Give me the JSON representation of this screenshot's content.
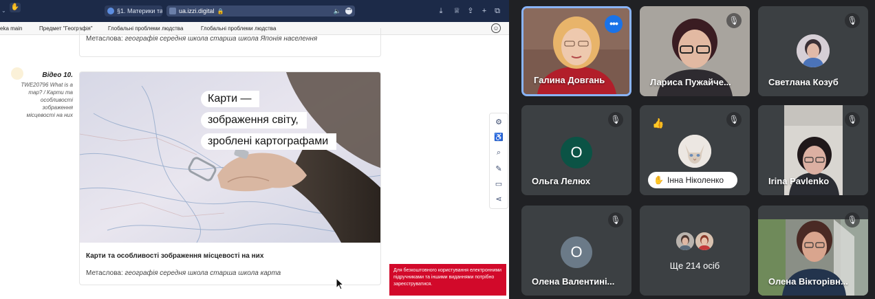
{
  "browser": {
    "tab_title": "§1. Материки та...",
    "url": "ua.izzi.digital"
  },
  "bookmarks": [
    "eka main",
    "Предмет \"Географія\"",
    "Глобальні проблеми людства",
    "Глобальні проблеми людства"
  ],
  "top_card": {
    "meta_label": "Метаслова:",
    "meta_value": "географія середня школа старша школа Японія населення"
  },
  "video": {
    "label": "Відео 10.",
    "description": "TWE20796 What is a map? / Карти та особливості зображення місцевості на них",
    "captions": [
      "Карти —",
      "зображення світу,",
      "зроблені картографами"
    ],
    "title": "Карти та особливості зображення місцевості на них",
    "meta_label": "Метаслова:",
    "meta_value": "географія середня школа старша школа карта"
  },
  "registration_banner": "Для безкоштовного користування електронними підручниками та іншими виданнями потрібно зареєструватися.",
  "participants": [
    {
      "name": "Галина Довгань"
    },
    {
      "name": "Лариса Пужайче..."
    },
    {
      "name": "Светлана Козуб"
    },
    {
      "name": "Ольга Лелюх",
      "initial": "О"
    },
    {
      "name": "Інна Ніколенко"
    },
    {
      "name": "Irina Pavlenko"
    },
    {
      "name": "Олена Валентині...",
      "initial": "О"
    },
    {
      "name": "Ще 214 осіб"
    },
    {
      "name": "Олена Вікторівн..."
    }
  ],
  "colors": {
    "meeting_bg": "#202124",
    "tile_bg": "#3c4043",
    "active_border": "#8ab4f8",
    "banner_red": "#d2092a",
    "avatar_green": "#0b5345",
    "avatar_grey": "#6b7a88"
  }
}
